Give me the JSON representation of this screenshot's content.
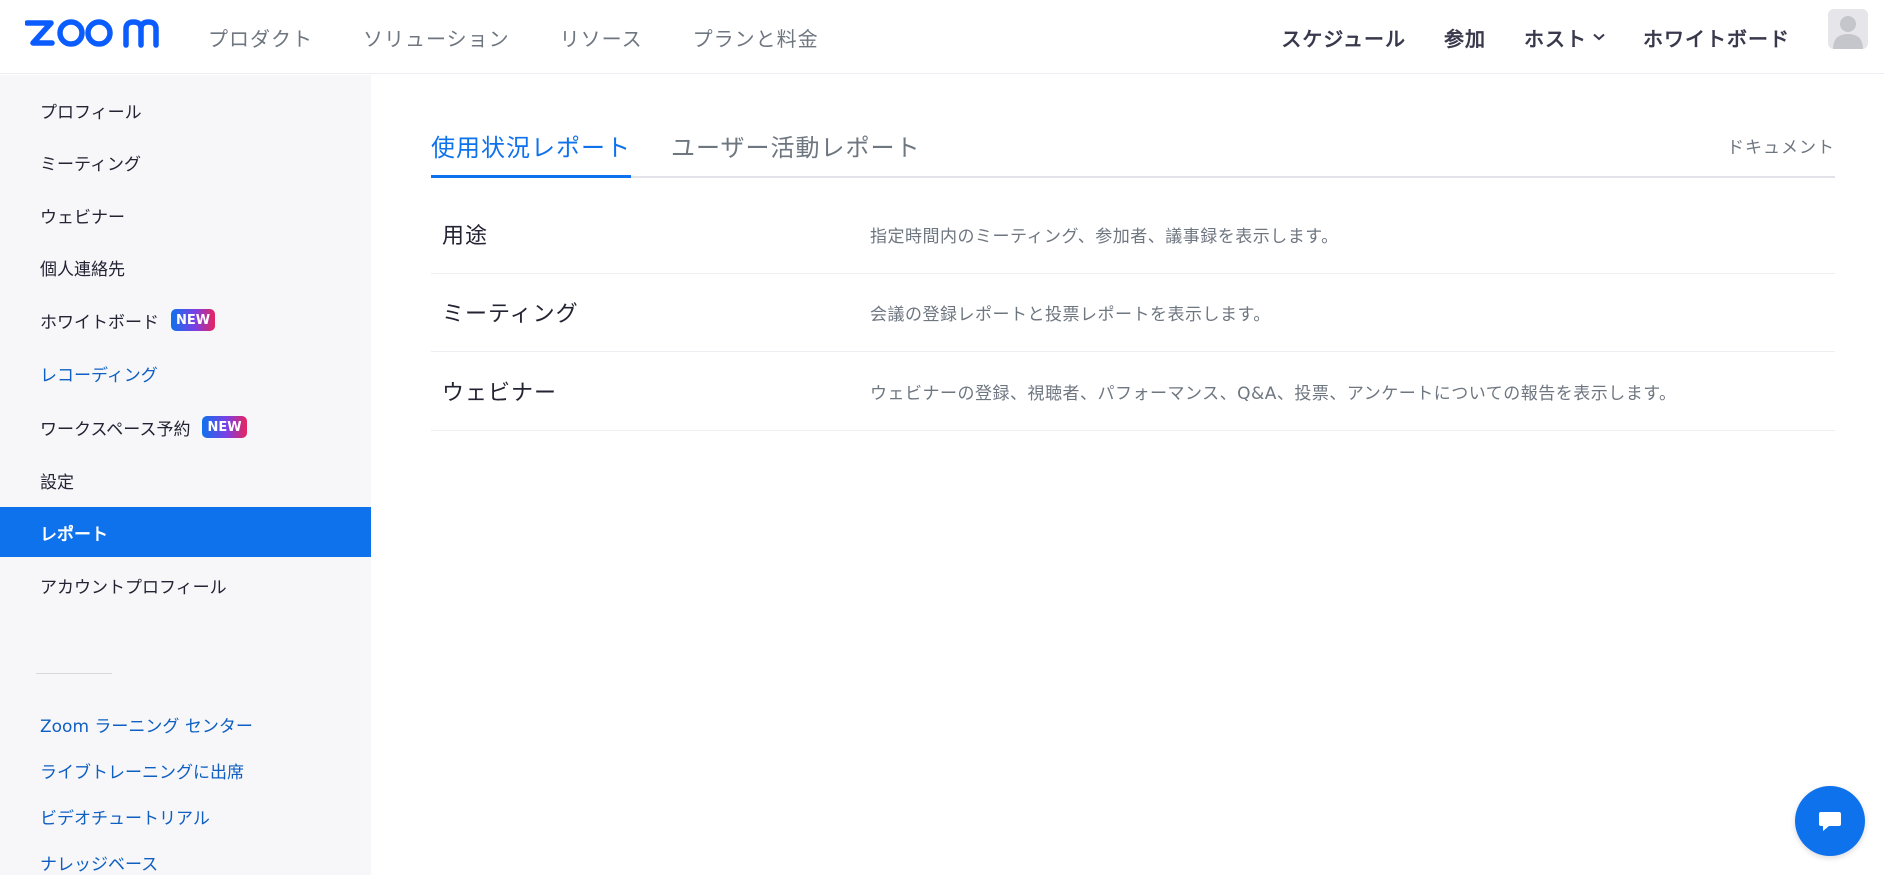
{
  "header": {
    "logo_text": "zoom",
    "nav_left": [
      "プロダクト",
      "ソリューション",
      "リソース",
      "プランと料金"
    ],
    "nav_right": {
      "schedule": "スケジュール",
      "join": "参加",
      "host": "ホスト",
      "whiteboard": "ホワイトボード"
    }
  },
  "sidebar": {
    "items": [
      {
        "label": "プロフィール"
      },
      {
        "label": "ミーティング"
      },
      {
        "label": "ウェビナー"
      },
      {
        "label": "個人連絡先"
      },
      {
        "label": "ホワイトボード",
        "badge": "NEW"
      },
      {
        "label": "レコーディング"
      },
      {
        "label": "ワークスペース予約",
        "badge": "NEW"
      },
      {
        "label": "設定"
      },
      {
        "label": "レポート"
      },
      {
        "label": "アカウントプロフィール"
      }
    ],
    "links": [
      "Zoom ラーニング センター",
      "ライブトレーニングに出席",
      "ビデオチュートリアル",
      "ナレッジベース"
    ]
  },
  "main": {
    "tabs": [
      "使用状況レポート",
      "ユーザー活動レポート"
    ],
    "doc_link": "ドキュメント",
    "reports": [
      {
        "name": "用途",
        "desc": "指定時間内のミーティング、参加者、議事録を表示します。"
      },
      {
        "name": "ミーティング",
        "desc": "会議の登録レポートと投票レポートを表示します。"
      },
      {
        "name": "ウェビナー",
        "desc": "ウェビナーの登録、視聴者、パフォーマンス、Q&A、投票、アンケートについての報告を表示します。"
      }
    ]
  },
  "colors": {
    "accent": "#0e72ed",
    "link": "#0e5fc1",
    "sidebar_bg": "#f7f7fa",
    "muted": "#6e7680"
  },
  "icons": {
    "host_dropdown": "chevron-down-icon",
    "avatar": "user-avatar-icon",
    "chat": "chat-bubble-icon"
  }
}
